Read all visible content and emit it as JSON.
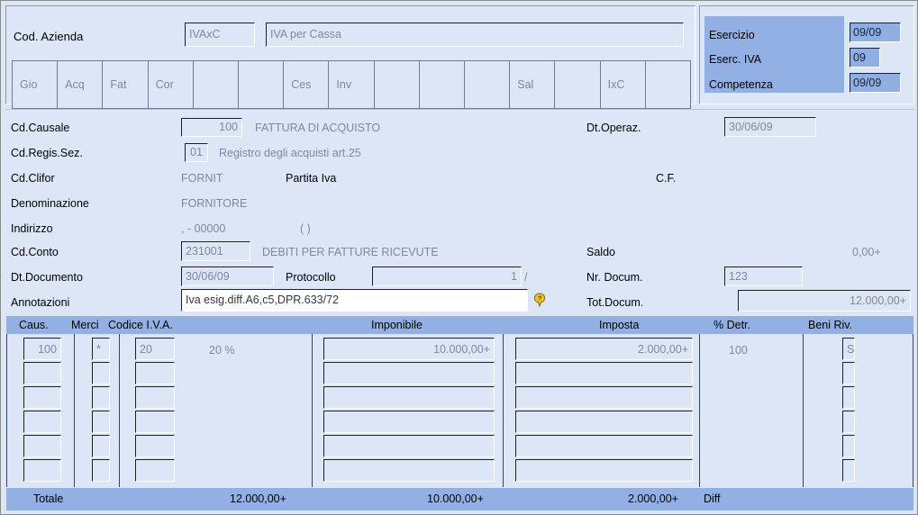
{
  "header": {
    "cod_azienda_label": "Cod. Azienda",
    "cod_azienda_value": "IVAxC",
    "descrizione_value": "IVA per Cassa"
  },
  "tabs": [
    {
      "label": "Gio"
    },
    {
      "label": "Acq"
    },
    {
      "label": "Fat"
    },
    {
      "label": "Cor"
    },
    {
      "label": ""
    },
    {
      "label": ""
    },
    {
      "label": "Ces"
    },
    {
      "label": "Inv"
    },
    {
      "label": ""
    },
    {
      "label": ""
    },
    {
      "label": ""
    },
    {
      "label": "Sal"
    },
    {
      "label": ""
    },
    {
      "label": "IxC"
    },
    {
      "label": ""
    }
  ],
  "exercise_panel": {
    "esercizio_label": "Esercizio",
    "esercizio_value": "09/09",
    "eserc_iva_label": "Eserc. IVA",
    "eserc_iva_value": "09",
    "competenza_label": "Competenza",
    "competenza_value": "09/09",
    "panel_color": "#92b0e4"
  },
  "form": {
    "cd_causale_label": "Cd.Causale",
    "cd_causale_value": "100",
    "cd_causale_desc": "FATTURA DI ACQUISTO",
    "dt_operaz_label": "Dt.Operaz.",
    "dt_operaz_value": "30/06/09",
    "cd_regis_sez_label": "Cd.Regis.Sez.",
    "cd_regis_sez_value": "01",
    "cd_regis_sez_desc": "Registro degli acquisti art.25",
    "cd_clifor_label": "Cd.Clifor",
    "cd_clifor_value": "FORNIT",
    "partita_iva_label": "Partita Iva",
    "cf_label": "C.F.",
    "denominazione_label": "Denominazione",
    "denominazione_value": "FORNITORE",
    "indirizzo_label": "Indirizzo",
    "indirizzo_value": ", - 00000",
    "indirizzo_paren": "(        )",
    "cd_conto_label": "Cd.Conto",
    "cd_conto_value": "231001",
    "cd_conto_desc": "DEBITI PER FATTURE RICEVUTE",
    "saldo_label": "Saldo",
    "saldo_value": "0,00+",
    "dt_documento_label": "Dt.Documento",
    "dt_documento_value": "30/06/09",
    "protocollo_label": "Protocollo",
    "protocollo_value": "1",
    "protocollo_sep": "/",
    "nr_docum_label": "Nr. Docum.",
    "nr_docum_value": "123",
    "annotazioni_label": "Annotazioni",
    "annotazioni_value": "Iva esig.diff.A6,c5,DPR.633/72",
    "tot_docum_label": "Tot.Docum.",
    "tot_docum_value": "12.000,00+"
  },
  "grid": {
    "columns": [
      {
        "key": "caus",
        "label": "Caus."
      },
      {
        "key": "merci",
        "label": "Merci"
      },
      {
        "key": "codice_iva",
        "label": "Codice I.V.A."
      },
      {
        "key": "imponibile",
        "label": "Imponibile"
      },
      {
        "key": "imposta",
        "label": "Imposta"
      },
      {
        "key": "perc_detr",
        "label": "% Detr."
      },
      {
        "key": "beni_riv",
        "label": "Beni Riv."
      }
    ],
    "rows": [
      {
        "caus": "100",
        "merci": "*",
        "codice_iva": "20",
        "aliquota": "20 %",
        "imponibile": "10.000,00+",
        "imposta": "2.000,00+",
        "perc_detr": "100",
        "beni_riv": "S"
      },
      {
        "caus": "",
        "merci": "",
        "codice_iva": "",
        "aliquota": "",
        "imponibile": "",
        "imposta": "",
        "perc_detr": "",
        "beni_riv": ""
      },
      {
        "caus": "",
        "merci": "",
        "codice_iva": "",
        "aliquota": "",
        "imponibile": "",
        "imposta": "",
        "perc_detr": "",
        "beni_riv": ""
      },
      {
        "caus": "",
        "merci": "",
        "codice_iva": "",
        "aliquota": "",
        "imponibile": "",
        "imposta": "",
        "perc_detr": "",
        "beni_riv": ""
      },
      {
        "caus": "",
        "merci": "",
        "codice_iva": "",
        "aliquota": "",
        "imponibile": "",
        "imposta": "",
        "perc_detr": "",
        "beni_riv": ""
      },
      {
        "caus": "",
        "merci": "",
        "codice_iva": "",
        "aliquota": "",
        "imponibile": "",
        "imposta": "",
        "perc_detr": "",
        "beni_riv": ""
      }
    ]
  },
  "totals": {
    "label": "Totale",
    "documento": "12.000,00+",
    "imponibile": "10.000,00+",
    "imposta": "2.000,00+",
    "diff_label": "Diff"
  },
  "icons": {
    "help": "help-balloon-icon"
  }
}
